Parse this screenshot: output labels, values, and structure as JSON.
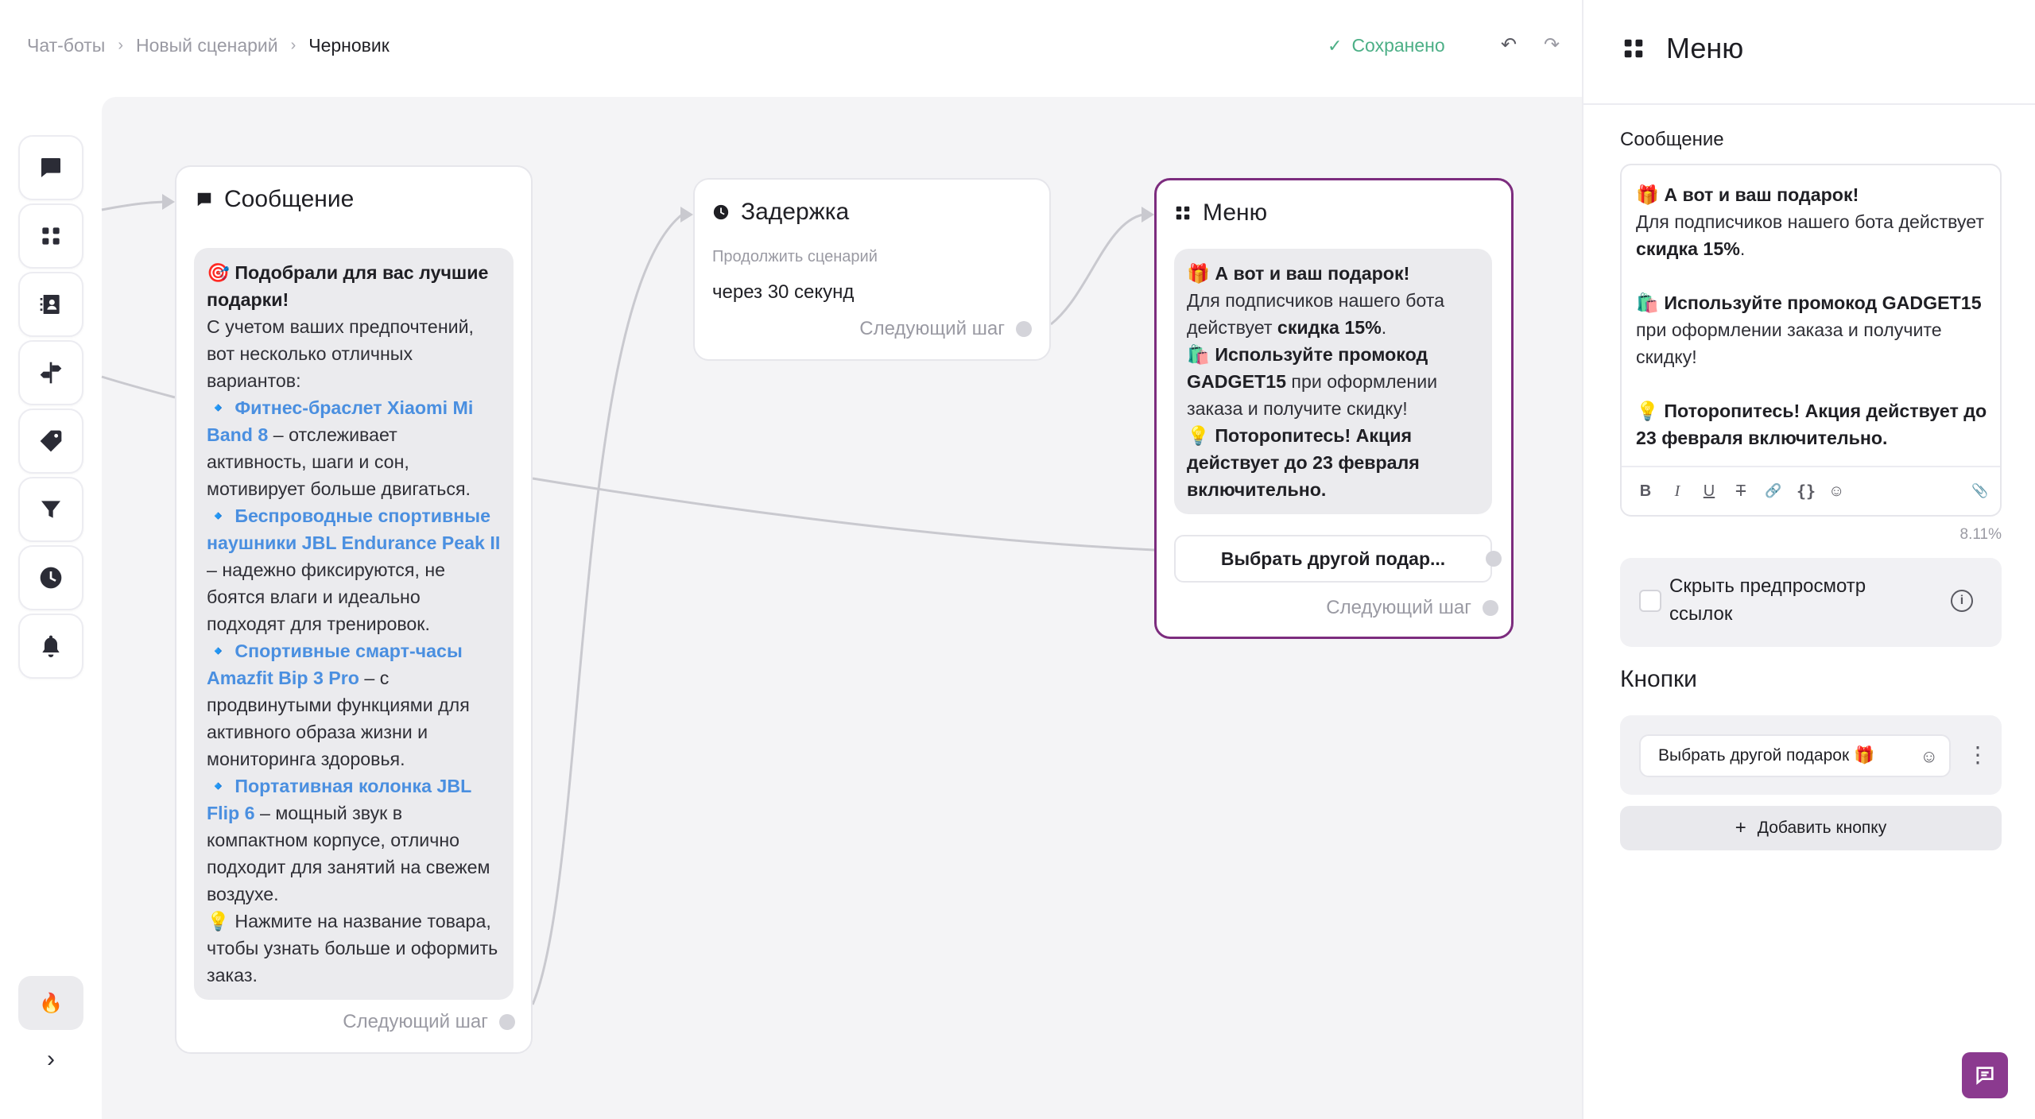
{
  "breadcrumb": {
    "items": [
      "Чат-боты",
      "Новый сценарий"
    ],
    "current": "Черновик",
    "separator": "›"
  },
  "status": {
    "saved": "Сохранено",
    "check": "✓"
  },
  "history": {
    "undo": "↶",
    "redo": "↷"
  },
  "rail": {
    "icons": [
      "chat-icon",
      "grid-icon",
      "contacts-icon",
      "signpost-icon",
      "tag-icon",
      "filter-icon",
      "clock-icon",
      "bell-icon"
    ],
    "fire": "🔥",
    "chevron": "›"
  },
  "nodes": {
    "message": {
      "title": "Сообщение",
      "bubble": {
        "intro_emoji": "🎯",
        "intro_bold": "Подобрали для вас лучшие подарки!",
        "intro_text": "С учетом ваших предпочтений, вот несколько отличных вариантов:",
        "items": [
          {
            "bullet": "🔹",
            "link": "Фитнес-браслет Xiaomi Mi Band 8",
            "text": " – отслеживает активность, шаги и сон, мотивирует больше двигаться."
          },
          {
            "bullet": "🔹",
            "link": "Беспроводные спортивные наушники JBL Endurance Peak II",
            "text": " – надежно фиксируются, не боятся влаги и идеально подходят для тренировок."
          },
          {
            "bullet": "🔹",
            "link": "Спортивные смарт-часы Amazfit Bip 3 Pro",
            "text": " – с продвинутыми функциями для активного образа жизни и мониторинга здоровья."
          },
          {
            "bullet": "🔹",
            "link": "Портативная колонка JBL Flip 6",
            "text": " – мощный звук в компактном корпусе, отлично подходит для занятий на свежем воздухе."
          }
        ],
        "outro_emoji": "💡",
        "outro_text": "Нажмите на название товара, чтобы узнать больше и оформить заказ."
      },
      "next_step": "Следующий шаг"
    },
    "delay": {
      "title": "Задержка",
      "label": "Продолжить сценарий",
      "value": "через 30 секунд",
      "next_step": "Следующий шаг"
    },
    "menu": {
      "title": "Меню",
      "bubble": {
        "l1_emoji": "🎁",
        "l1_bold": "А вот и ваш подарок!",
        "l2_pre": "Для подписчиков нашего бота действует ",
        "l2_bold": "скидка 15%",
        "l2_post": ".",
        "l3_emoji": "🛍️",
        "l3_bold": "Используйте промокод GADGET15",
        "l3_post": " при оформлении заказа и получите скидку!",
        "l4_emoji": "💡",
        "l4_bold": "Поторопитесь! Акция действует до 23 февраля включительно."
      },
      "button": "Выбрать другой подар...",
      "next_step": "Следующий шаг"
    }
  },
  "panel": {
    "title": "Меню",
    "message_label": "Сообщение",
    "editor": {
      "l1_emoji": "🎁",
      "l1_bold": "А вот и ваш подарок!",
      "l2_pre": "Для подписчиков нашего бота действует ",
      "l2_bold": "скидка 15%",
      "l2_post": ".",
      "l3_emoji": "🛍️",
      "l3_bold": "Используйте промокод GADGET15",
      "l3_post": " при оформлении заказа и получите скидку!",
      "l4_emoji": "💡",
      "l4_bold": "Поторопитесь! Акция действует до 23 февраля включительно."
    },
    "toolbar": {
      "bold": "B",
      "italic": "I",
      "underline": "U",
      "strike": "T",
      "link": "🔗",
      "braces": "{}",
      "emoji": "☺",
      "attach": "📎"
    },
    "percent": "8.11%",
    "hide_preview": "Скрыть предпросмотр ссылок",
    "info": "i",
    "buttons_title": "Кнопки",
    "button_value": "Выбрать другой подарок 🎁",
    "button_smile": "☺",
    "kebab": "⋮",
    "add_button": "Добавить кнопку",
    "add_plus": "+"
  },
  "colors": {
    "accent": "#7c2c7e",
    "saved": "#4caf86",
    "link": "#4a8fe0",
    "canvas": "#f4f4f6",
    "fab": "#8b3a8f"
  }
}
